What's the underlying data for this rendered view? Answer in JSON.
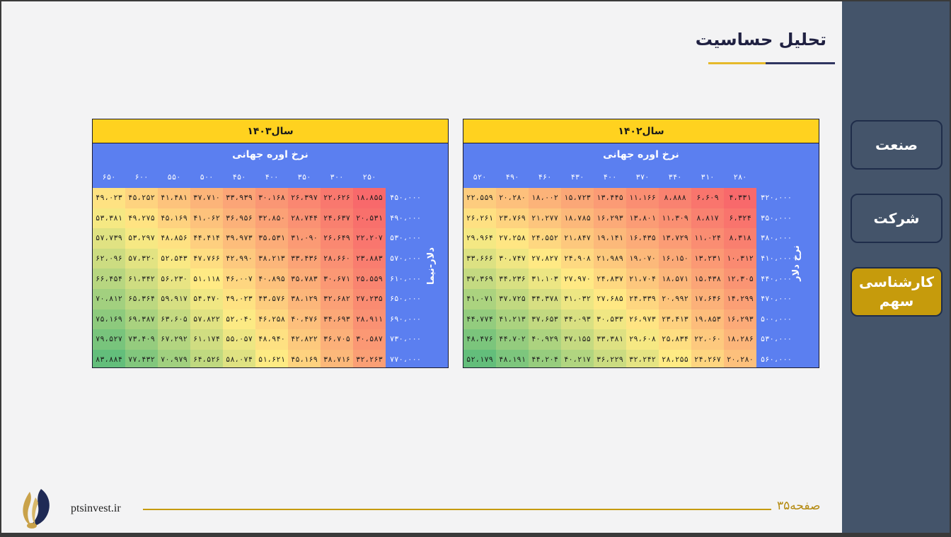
{
  "title": "تحلیل حساسیت",
  "sidebar": {
    "items": [
      {
        "label": "صنعت",
        "active": false
      },
      {
        "label": "شرکت",
        "active": false
      },
      {
        "label": "کارشناسی سهم",
        "active": true
      }
    ]
  },
  "colors": {
    "header": "#ffd21f",
    "blue": "#5b7ff0",
    "sidebar": "#44546a",
    "accent": "#c69b0c"
  },
  "tables": [
    {
      "header": "سال۱۴۰۲",
      "col_title": "نرخ اوره جهانی",
      "row_title": "نرخ دلار",
      "cols": [
        "۲۸۰",
        "۳۱۰",
        "۳۴۰",
        "۳۷۰",
        "۴۰۰",
        "۴۳۰",
        "۴۶۰",
        "۴۹۰",
        "۵۲۰"
      ],
      "rows": [
        "۳۲۰،۰۰۰",
        "۳۵۰،۰۰۰",
        "۳۸۰،۰۰۰",
        "۴۱۰،۰۰۰",
        "۴۴۰،۰۰۰",
        "۴۷۰،۰۰۰",
        "۵۰۰،۰۰۰",
        "۵۳۰،۰۰۰",
        "۵۶۰،۰۰۰"
      ],
      "values": [
        [
          "۴،۳۳۱",
          "۶،۶۰۹",
          "۸،۸۸۸",
          "۱۱،۱۶۶",
          "۱۳،۴۴۵",
          "۱۵،۷۲۳",
          "۱۸،۰۰۲",
          "۲۰،۲۸۰",
          "۲۲،۵۵۹"
        ],
        [
          "۶،۳۲۴",
          "۸،۸۱۷",
          "۱۱،۳۰۹",
          "۱۳،۸۰۱",
          "۱۶،۲۹۳",
          "۱۸،۷۸۵",
          "۲۱،۲۷۷",
          "۲۳،۷۶۹",
          "۲۶،۲۶۱"
        ],
        [
          "۸،۳۱۸",
          "۱۱،۰۲۴",
          "۱۳،۷۲۹",
          "۱۶،۴۳۵",
          "۱۹،۱۴۱",
          "۲۱،۸۴۷",
          "۲۴،۵۵۲",
          "۲۷،۲۵۸",
          "۲۹،۹۶۴"
        ],
        [
          "۱۰،۳۱۲",
          "۱۳،۲۳۱",
          "۱۶،۱۵۰",
          "۱۹،۰۷۰",
          "۲۱،۹۸۹",
          "۲۴،۹۰۸",
          "۲۷،۸۲۷",
          "۳۰،۷۴۷",
          "۳۳،۶۶۶"
        ],
        [
          "۱۲،۳۰۵",
          "۱۵،۴۳۸",
          "۱۸،۵۷۱",
          "۲۱،۷۰۴",
          "۲۴،۸۳۷",
          "۲۷،۹۷۰",
          "۳۱،۱۰۳",
          "۳۴،۲۳۶",
          "۳۷،۳۶۹"
        ],
        [
          "۱۴،۲۹۹",
          "۱۷،۶۴۶",
          "۲۰،۹۹۲",
          "۲۴،۳۳۹",
          "۲۷،۶۸۵",
          "۳۱،۰۳۲",
          "۳۴،۳۷۸",
          "۳۷،۷۲۵",
          "۴۱،۰۷۱"
        ],
        [
          "۱۶،۲۹۳",
          "۱۹،۸۵۳",
          "۲۳،۴۱۳",
          "۲۶،۹۷۳",
          "۳۰،۵۳۳",
          "۳۴،۰۹۳",
          "۳۷،۶۵۳",
          "۴۱،۲۱۳",
          "۴۴،۷۷۴"
        ],
        [
          "۱۸،۲۸۶",
          "۲۲،۰۶۰",
          "۲۵،۸۳۴",
          "۲۹،۶۰۸",
          "۳۳،۳۸۱",
          "۳۷،۱۵۵",
          "۴۰،۹۲۹",
          "۴۴،۷۰۲",
          "۴۸،۴۷۶"
        ],
        [
          "۲۰،۲۸۰",
          "۲۴،۲۶۷",
          "۲۸،۲۵۵",
          "۳۲،۲۴۲",
          "۳۶،۲۲۹",
          "۴۰،۲۱۷",
          "۴۴،۲۰۴",
          "۴۸،۱۹۱",
          "۵۲،۱۷۹"
        ]
      ],
      "numeric": [
        [
          4331,
          6609,
          8888,
          11166,
          13445,
          15723,
          18002,
          20280,
          22559
        ],
        [
          6324,
          8817,
          11309,
          13801,
          16293,
          18785,
          21277,
          23769,
          26261
        ],
        [
          8318,
          11024,
          13729,
          16435,
          19141,
          21847,
          24552,
          27258,
          29964
        ],
        [
          10312,
          13231,
          16150,
          19070,
          21989,
          24908,
          27827,
          30747,
          33666
        ],
        [
          12305,
          15438,
          18571,
          21704,
          24837,
          27970,
          31103,
          34236,
          37369
        ],
        [
          14299,
          17646,
          20992,
          24339,
          27685,
          31032,
          34378,
          37725,
          41071
        ],
        [
          16293,
          19853,
          23413,
          26973,
          30533,
          34093,
          37653,
          41213,
          44774
        ],
        [
          18286,
          22060,
          25834,
          29608,
          33381,
          37155,
          40929,
          44702,
          48476
        ],
        [
          20280,
          24267,
          28255,
          32242,
          36229,
          40217,
          44204,
          48191,
          52179
        ]
      ]
    },
    {
      "header": "سال۱۴۰۳",
      "col_title": "نرخ اوره جهانی",
      "row_title": "دلار-نیما",
      "cols": [
        "۲۵۰",
        "۳۰۰",
        "۳۵۰",
        "۴۰۰",
        "۴۵۰",
        "۵۰۰",
        "۵۵۰",
        "۶۰۰",
        "۶۵۰"
      ],
      "rows": [
        "۴۵۰،۰۰۰",
        "۴۹۰،۰۰۰",
        "۵۳۰،۰۰۰",
        "۵۷۰،۰۰۰",
        "۶۱۰،۰۰۰",
        "۶۵۰،۰۰۰",
        "۶۹۰،۰۰۰",
        "۷۳۰،۰۰۰",
        "۷۷۰،۰۰۰"
      ],
      "values": [
        [
          "۱۸،۸۵۵",
          "۲۲،۶۲۶",
          "۲۶،۳۹۷",
          "۳۰،۱۶۸",
          "۳۳،۹۳۹",
          "۳۷،۷۱۰",
          "۴۱،۴۸۱",
          "۴۵،۲۵۲",
          "۴۹،۰۲۳"
        ],
        [
          "۲۰،۵۳۱",
          "۲۴،۶۳۷",
          "۲۸،۷۴۴",
          "۳۲،۸۵۰",
          "۳۶،۹۵۶",
          "۴۱،۰۶۲",
          "۴۵،۱۶۹",
          "۴۹،۲۷۵",
          "۵۳،۳۸۱"
        ],
        [
          "۲۲،۲۰۷",
          "۲۶،۶۴۹",
          "۳۱،۰۹۰",
          "۳۵،۵۳۱",
          "۳۹،۹۷۳",
          "۴۴،۴۱۴",
          "۴۸،۸۵۶",
          "۵۳،۲۹۷",
          "۵۷،۷۳۹"
        ],
        [
          "۲۳،۸۸۳",
          "۲۸،۶۶۰",
          "۳۳،۴۳۶",
          "۳۸،۲۱۳",
          "۴۲،۹۹۰",
          "۴۷،۷۶۶",
          "۵۲،۵۴۳",
          "۵۷،۳۲۰",
          "۶۲،۰۹۶"
        ],
        [
          "۲۵،۵۵۹",
          "۳۰،۶۷۱",
          "۳۵،۷۸۳",
          "۴۰،۸۹۵",
          "۴۶،۰۰۷",
          "۵۱،۱۱۸",
          "۵۶،۲۳۰",
          "۶۱،۳۴۲",
          "۶۶،۴۵۴"
        ],
        [
          "۲۷،۲۳۵",
          "۳۲،۶۸۲",
          "۳۸،۱۲۹",
          "۴۳،۵۷۶",
          "۴۹،۰۲۳",
          "۵۴،۴۷۰",
          "۵۹،۹۱۷",
          "۶۵،۳۶۴",
          "۷۰،۸۱۲"
        ],
        [
          "۲۸،۹۱۱",
          "۳۴،۶۹۳",
          "۴۰،۴۷۶",
          "۴۶،۲۵۸",
          "۵۲،۰۴۰",
          "۵۷،۸۲۲",
          "۶۳،۶۰۵",
          "۶۹،۳۸۷",
          "۷۵،۱۶۹"
        ],
        [
          "۳۰،۵۸۷",
          "۳۶،۷۰۵",
          "۴۲،۸۲۲",
          "۴۸،۹۴۰",
          "۵۵،۰۵۷",
          "۶۱،۱۷۴",
          "۶۷،۲۹۲",
          "۷۳،۴۰۹",
          "۷۹،۵۲۷"
        ],
        [
          "۳۲،۲۶۳",
          "۳۸،۷۱۶",
          "۴۵،۱۶۹",
          "۵۱،۶۲۱",
          "۵۸،۰۷۴",
          "۶۴،۵۲۶",
          "۷۰،۹۷۹",
          "۷۷،۴۳۲",
          "۸۳،۸۸۴"
        ]
      ],
      "numeric": [
        [
          18855,
          22626,
          26397,
          30168,
          33939,
          37710,
          41481,
          45252,
          49023
        ],
        [
          20531,
          24637,
          28744,
          32850,
          36956,
          41062,
          45169,
          49275,
          53381
        ],
        [
          22207,
          26649,
          31090,
          35531,
          39973,
          44414,
          48856,
          53297,
          57739
        ],
        [
          23883,
          28660,
          33436,
          38213,
          42990,
          47766,
          52543,
          57320,
          62096
        ],
        [
          25559,
          30671,
          35783,
          40895,
          46007,
          51118,
          56230,
          61342,
          66454
        ],
        [
          27235,
          32682,
          38129,
          43576,
          49023,
          54470,
          59917,
          65364,
          70812
        ],
        [
          28911,
          34693,
          40476,
          46258,
          52040,
          57822,
          63605,
          69387,
          75169
        ],
        [
          30587,
          36705,
          42822,
          48940,
          55057,
          61174,
          67292,
          73409,
          79527
        ],
        [
          32263,
          38716,
          45169,
          51621,
          58074,
          64526,
          70979,
          77432,
          83884
        ]
      ]
    }
  ],
  "footer": {
    "url": "ptsinvest.ir",
    "page": "صفحه۳۵"
  }
}
